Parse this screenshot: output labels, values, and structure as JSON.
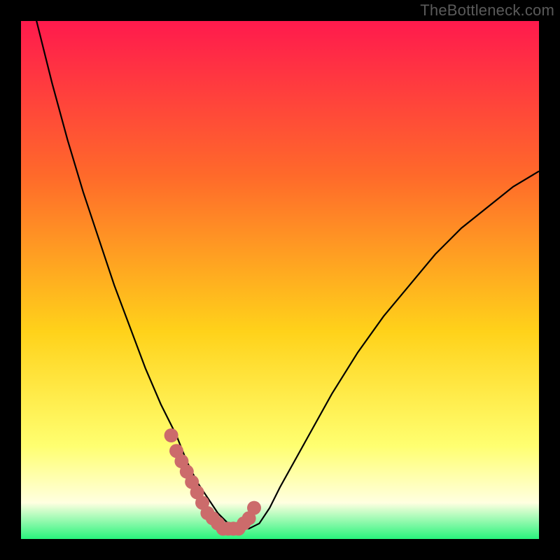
{
  "watermark": "TheBottleneck.com",
  "colors": {
    "frame": "#000000",
    "watermark": "#5a5a5a",
    "gradient_top": "#ff1a4d",
    "gradient_mid1": "#ff6a2a",
    "gradient_mid2": "#ffd21a",
    "gradient_mid3": "#ffff70",
    "gradient_mid4": "#ffffe0",
    "gradient_bottom": "#28f47c",
    "curve": "#000000",
    "markers": "#cc6b6b"
  },
  "chart_data": {
    "type": "line",
    "title": "",
    "xlabel": "",
    "ylabel": "",
    "xlim": [
      0,
      100
    ],
    "ylim": [
      0,
      100
    ],
    "x": [
      0,
      3,
      6,
      9,
      12,
      15,
      18,
      21,
      24,
      27,
      30,
      32,
      34,
      36,
      38,
      40,
      42,
      44,
      46,
      48,
      50,
      55,
      60,
      65,
      70,
      75,
      80,
      85,
      90,
      95,
      100
    ],
    "values": [
      110,
      100,
      88,
      77,
      67,
      58,
      49,
      41,
      33,
      26,
      20,
      15,
      11,
      8,
      5,
      3,
      2,
      2,
      3,
      6,
      10,
      19,
      28,
      36,
      43,
      49,
      55,
      60,
      64,
      68,
      71
    ],
    "marker_x": [
      29,
      30,
      31,
      32,
      33,
      34,
      35,
      36,
      37,
      38,
      39,
      40,
      41,
      42,
      43,
      44,
      45
    ],
    "marker_y": [
      20,
      17,
      15,
      13,
      11,
      9,
      7,
      5,
      4,
      3,
      2,
      2,
      2,
      2,
      3,
      4,
      6
    ]
  }
}
